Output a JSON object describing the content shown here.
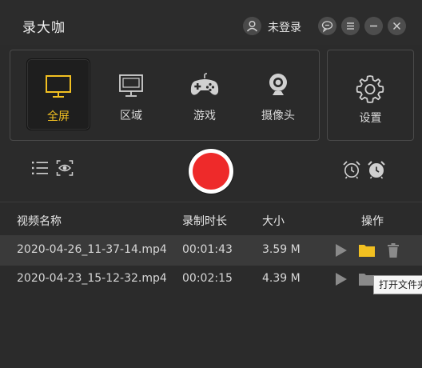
{
  "app": {
    "title": "录大咖"
  },
  "header": {
    "login_text": "未登录"
  },
  "modes": [
    {
      "label": "全屏",
      "icon": "monitor-icon",
      "active": true
    },
    {
      "label": "区域",
      "icon": "region-icon",
      "active": false
    },
    {
      "label": "游戏",
      "icon": "gamepad-icon",
      "active": false
    },
    {
      "label": "摄像头",
      "icon": "webcam-icon",
      "active": false
    }
  ],
  "settings": {
    "label": "设置",
    "icon": "gear-icon"
  },
  "table": {
    "headers": {
      "name": "视频名称",
      "duration": "录制时长",
      "size": "大小",
      "actions": "操作"
    },
    "rows": [
      {
        "name": "2020-04-26_11-37-14.mp4",
        "duration": "00:01:43",
        "size": "3.59 M",
        "selected": true
      },
      {
        "name": "2020-04-23_15-12-32.mp4",
        "duration": "00:02:15",
        "size": "4.39 M",
        "selected": false
      }
    ]
  },
  "tooltip": {
    "text": "打开文件夹"
  },
  "colors": {
    "accent": "#f2c021",
    "record": "#ee2a2a",
    "background": "#2b2b2b"
  }
}
